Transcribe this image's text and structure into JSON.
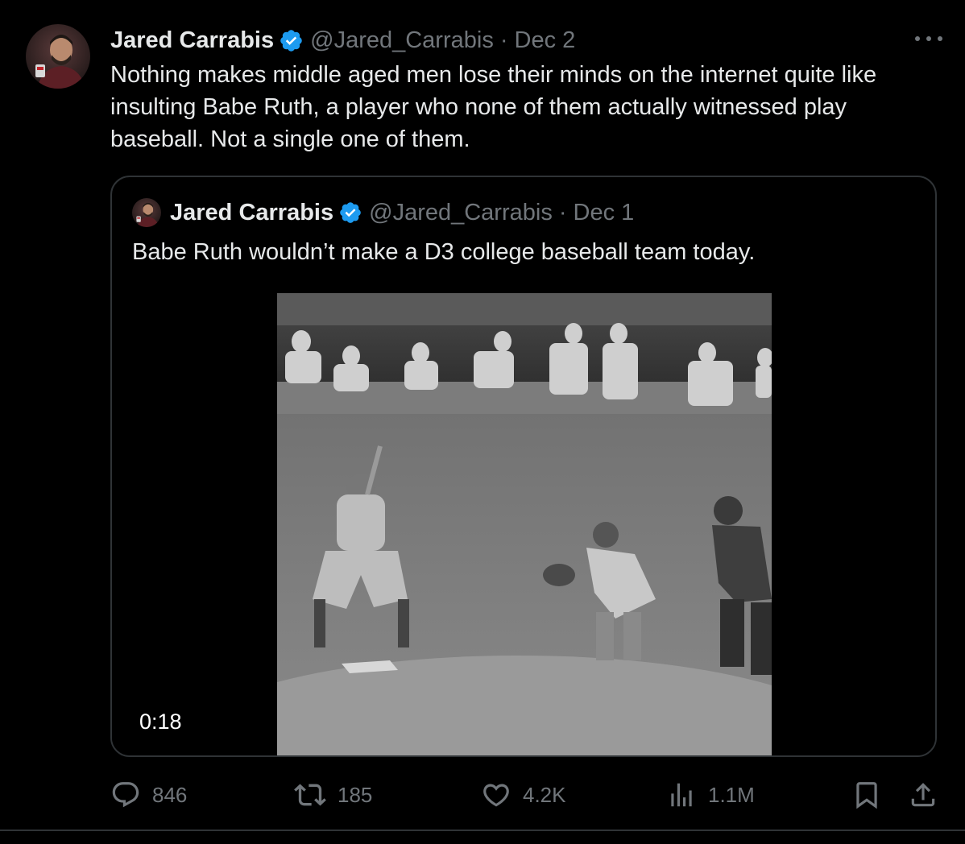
{
  "tweet": {
    "author_name": "Jared Carrabis",
    "handle": "@Jared_Carrabis",
    "separator": "·",
    "date": "Dec 2",
    "text": "Nothing makes middle aged men lose their minds on the internet quite like insulting Babe Ruth, a player who none of them actually witnessed play baseball. Not a single one of them.",
    "avatar_icon": "user-avatar",
    "more_icon": "more-horizontal-icon"
  },
  "quoted_tweet": {
    "author_name": "Jared Carrabis",
    "handle": "@Jared_Carrabis",
    "separator": "·",
    "date": "Dec 1",
    "text": "Babe Ruth wouldn’t make a D3 college baseball team today.",
    "video_duration": "0:18"
  },
  "actions": {
    "replies": "846",
    "reposts": "185",
    "likes": "4.2K",
    "views": "1.1M",
    "icons": [
      "reply-icon",
      "repost-icon",
      "like-icon",
      "views-icon",
      "bookmark-icon",
      "share-icon"
    ]
  },
  "colors": {
    "background": "#000000",
    "text_primary": "#e7e9ea",
    "text_secondary": "#71767b",
    "verified": "#1d9bf0",
    "border": "#2f3336"
  }
}
